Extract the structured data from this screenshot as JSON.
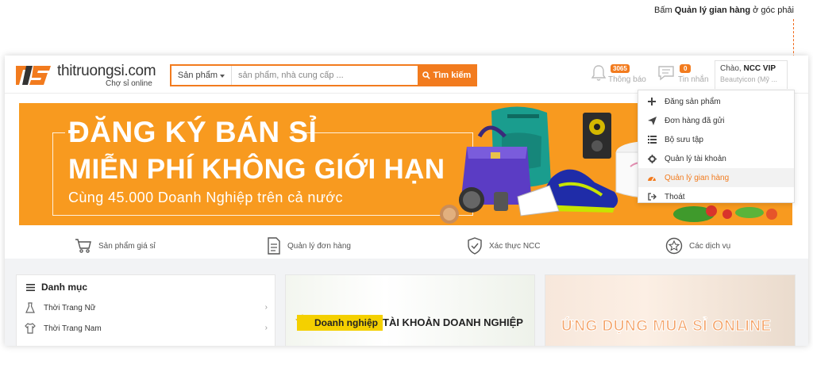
{
  "annotation": {
    "prefix": "Bấm ",
    "highlight": "Quản lý gian hàng",
    "suffix": " ở góc phải"
  },
  "header": {
    "logo_name": "thitruongsi.com",
    "logo_tagline": "Chợ sỉ online",
    "search": {
      "category": "Sản phẩm",
      "placeholder": "sản phẩm, nhà cung cấp ...",
      "button_label": "Tìm kiếm"
    },
    "notifications": {
      "count": "3065",
      "label": "Thông báo"
    },
    "messages": {
      "count": "0",
      "label": "Tin nhắn"
    },
    "account": {
      "greeting": "Chào, ",
      "name": "NCC VIP",
      "shop": "Beautyicon (Mỹ ..."
    }
  },
  "account_menu": [
    {
      "label": "Đăng sản phẩm",
      "icon": "plus-icon",
      "active": false
    },
    {
      "label": "Đơn hàng đã gửi",
      "icon": "send-icon",
      "active": false
    },
    {
      "label": "Bộ sưu tập",
      "icon": "list-icon",
      "active": false
    },
    {
      "label": "Quản lý tài khoản",
      "icon": "gear-icon",
      "active": false
    },
    {
      "label": "Quản lý gian hàng",
      "icon": "dashboard-icon",
      "active": true
    },
    {
      "label": "Thoát",
      "icon": "logout-icon",
      "active": false
    }
  ],
  "banner": {
    "line1": "ĐĂNG KÝ BÁN SỈ",
    "line2": "MIỄN PHÍ KHÔNG GIỚI HẠN",
    "line3": "Cùng 45.000 Doanh Nghiệp trên cả nước"
  },
  "services": [
    {
      "label": "Sản phẩm giá sỉ",
      "icon": "cart-icon"
    },
    {
      "label": "Quản lý đơn hàng",
      "icon": "document-icon"
    },
    {
      "label": "Xác thực NCC",
      "icon": "shield-icon"
    },
    {
      "label": "Các dịch vụ",
      "icon": "star-badge-icon"
    }
  ],
  "categories": {
    "title": "Danh mục",
    "items": [
      {
        "label": "Thời Trang Nữ",
        "icon": "dress-icon"
      },
      {
        "label": "Thời Trang Nam",
        "icon": "shirt-icon"
      }
    ]
  },
  "promos": {
    "business_badge": "Doanh nghiệp",
    "business_title": "TÀI KHOẢN DOANH NGHIỆP",
    "app_title": "ỨNG DỤNG MUA SỈ ONLINE"
  },
  "colors": {
    "accent": "#f27b1e",
    "banner": "#f89a1f",
    "badge_yellow": "#f4d000"
  }
}
